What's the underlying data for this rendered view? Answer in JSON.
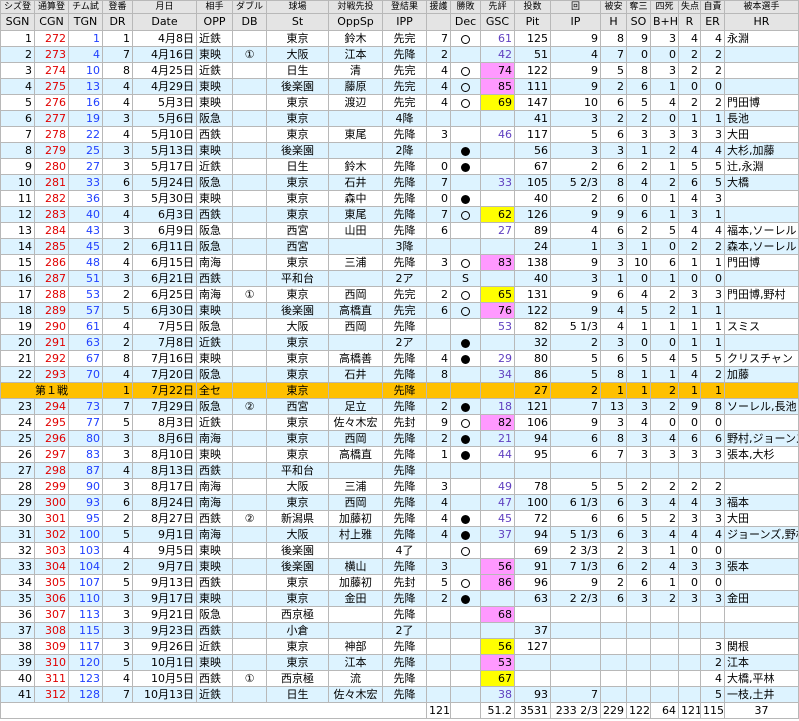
{
  "header_jp": [
    "シズ登",
    "通算登",
    "チム試",
    "登番",
    "月日",
    "相手",
    "ダブル",
    "球場",
    "対戦先投",
    "登結果",
    "援護",
    "勝敗",
    "先評",
    "投数",
    "回",
    "被安",
    "奪三",
    "四死",
    "失点",
    "自責",
    "被本選手"
  ],
  "header_en": [
    "SGN",
    "CGN",
    "TGN",
    "DR",
    "Date",
    "OPP",
    "DB",
    "St",
    "OppSp",
    "IPP",
    "",
    "Dec",
    "GSC",
    "Pit",
    "IP",
    "H",
    "SO",
    "B+H",
    "R",
    "ER",
    "HR"
  ],
  "rows": [
    {
      "sgn": "1",
      "cgn": "272",
      "tgn": "1",
      "dr": "1",
      "date": "4月8日",
      "opp": "近鉄",
      "db": "",
      "st": "東京",
      "oppsp": "鈴木",
      "ipp": "先完",
      "sup": "7",
      "dec": "o",
      "gsc": "61",
      "gsc_style": "none",
      "pit": "125",
      "ip": "9",
      "h": "8",
      "so": "9",
      "bh": "3",
      "r": "4",
      "er": "4",
      "hr": "永淵"
    },
    {
      "sgn": "2",
      "cgn": "273",
      "tgn": "4",
      "dr": "7",
      "date": "4月16日",
      "opp": "東映",
      "db": "①",
      "st": "大阪",
      "oppsp": "江本",
      "ipp": "先降",
      "sup": "2",
      "dec": "",
      "gsc": "42",
      "gsc_style": "none",
      "pit": "51",
      "ip": "4",
      "h": "7",
      "so": "0",
      "bh": "0",
      "r": "2",
      "er": "2",
      "hr": ""
    },
    {
      "sgn": "3",
      "cgn": "274",
      "tgn": "10",
      "dr": "8",
      "date": "4月25日",
      "opp": "近鉄",
      "db": "",
      "st": "日生",
      "oppsp": "清",
      "ipp": "先完",
      "sup": "4",
      "dec": "o",
      "gsc": "74",
      "gsc_style": "pink",
      "pit": "122",
      "ip": "9",
      "h": "5",
      "so": "8",
      "bh": "3",
      "r": "2",
      "er": "2",
      "hr": ""
    },
    {
      "sgn": "4",
      "cgn": "275",
      "tgn": "13",
      "dr": "4",
      "date": "4月29日",
      "opp": "東映",
      "db": "",
      "st": "後楽園",
      "oppsp": "藤原",
      "ipp": "先完",
      "sup": "4",
      "dec": "o",
      "gsc": "85",
      "gsc_style": "pink",
      "pit": "111",
      "ip": "9",
      "h": "2",
      "so": "6",
      "bh": "1",
      "r": "0",
      "er": "0",
      "hr": ""
    },
    {
      "sgn": "5",
      "cgn": "276",
      "tgn": "16",
      "dr": "4",
      "date": "5月3日",
      "opp": "東映",
      "db": "",
      "st": "東京",
      "oppsp": "渡辺",
      "ipp": "先完",
      "sup": "4",
      "dec": "o",
      "gsc": "69",
      "gsc_style": "ylw",
      "pit": "147",
      "ip": "10",
      "h": "6",
      "so": "5",
      "bh": "4",
      "r": "2",
      "er": "2",
      "hr": "門田博"
    },
    {
      "sgn": "6",
      "cgn": "277",
      "tgn": "19",
      "dr": "3",
      "date": "5月6日",
      "opp": "阪急",
      "db": "",
      "st": "東京",
      "oppsp": "",
      "ipp": "4降",
      "sup": "",
      "dec": "",
      "gsc": "",
      "gsc_style": "none",
      "pit": "41",
      "ip": "3",
      "h": "2",
      "so": "2",
      "bh": "0",
      "r": "1",
      "er": "1",
      "hr": "長池"
    },
    {
      "sgn": "7",
      "cgn": "278",
      "tgn": "22",
      "dr": "4",
      "date": "5月10日",
      "opp": "西鉄",
      "db": "",
      "st": "東京",
      "oppsp": "東尾",
      "ipp": "先降",
      "sup": "3",
      "dec": "",
      "gsc": "46",
      "gsc_style": "none",
      "pit": "117",
      "ip": "5",
      "h": "6",
      "so": "3",
      "bh": "3",
      "r": "3",
      "er": "3",
      "hr": "大田"
    },
    {
      "sgn": "8",
      "cgn": "279",
      "tgn": "25",
      "dr": "3",
      "date": "5月13日",
      "opp": "東映",
      "db": "",
      "st": "後楽園",
      "oppsp": "",
      "ipp": "2降",
      "sup": "",
      "dec": "b",
      "gsc": "",
      "gsc_style": "none",
      "pit": "56",
      "ip": "3",
      "h": "3",
      "so": "1",
      "bh": "2",
      "r": "4",
      "er": "4",
      "hr": "大杉,加藤"
    },
    {
      "sgn": "9",
      "cgn": "280",
      "tgn": "27",
      "dr": "3",
      "date": "5月17日",
      "opp": "近鉄",
      "db": "",
      "st": "日生",
      "oppsp": "鈴木",
      "ipp": "先降",
      "sup": "0",
      "dec": "b",
      "gsc": "",
      "gsc_style": "none",
      "pit": "67",
      "ip": "2",
      "h": "6",
      "so": "2",
      "bh": "1",
      "r": "5",
      "er": "5",
      "hr": "辻,永淵"
    },
    {
      "sgn": "10",
      "cgn": "281",
      "tgn": "33",
      "dr": "6",
      "date": "5月24日",
      "opp": "阪急",
      "db": "",
      "st": "東京",
      "oppsp": "石井",
      "ipp": "先降",
      "sup": "7",
      "dec": "",
      "gsc": "33",
      "gsc_style": "none",
      "pit": "105",
      "ip": "5 2/3",
      "h": "8",
      "so": "4",
      "bh": "2",
      "r": "6",
      "er": "5",
      "hr": "大橋"
    },
    {
      "sgn": "11",
      "cgn": "282",
      "tgn": "36",
      "dr": "3",
      "date": "5月30日",
      "opp": "東映",
      "db": "",
      "st": "東京",
      "oppsp": "森中",
      "ipp": "先降",
      "sup": "0",
      "dec": "b",
      "gsc": "",
      "gsc_style": "none",
      "pit": "40",
      "ip": "2",
      "h": "6",
      "so": "0",
      "bh": "1",
      "r": "4",
      "er": "3",
      "hr": ""
    },
    {
      "sgn": "12",
      "cgn": "283",
      "tgn": "40",
      "dr": "4",
      "date": "6月3日",
      "opp": "西鉄",
      "db": "",
      "st": "東京",
      "oppsp": "東尾",
      "ipp": "先降",
      "sup": "7",
      "dec": "o",
      "gsc": "62",
      "gsc_style": "ylw",
      "pit": "126",
      "ip": "9",
      "h": "9",
      "so": "6",
      "bh": "1",
      "r": "3",
      "er": "1",
      "hr": ""
    },
    {
      "sgn": "13",
      "cgn": "284",
      "tgn": "43",
      "dr": "3",
      "date": "6月9日",
      "opp": "阪急",
      "db": "",
      "st": "西宮",
      "oppsp": "山田",
      "ipp": "先降",
      "sup": "6",
      "dec": "",
      "gsc": "27",
      "gsc_style": "none",
      "pit": "89",
      "ip": "4",
      "h": "6",
      "so": "2",
      "bh": "5",
      "r": "4",
      "er": "4",
      "hr": "福本,ソーレル"
    },
    {
      "sgn": "14",
      "cgn": "285",
      "tgn": "45",
      "dr": "2",
      "date": "6月11日",
      "opp": "阪急",
      "db": "",
      "st": "西宮",
      "oppsp": "",
      "ipp": "3降",
      "sup": "",
      "dec": "",
      "gsc": "",
      "gsc_style": "none",
      "pit": "24",
      "ip": "1",
      "h": "3",
      "so": "1",
      "bh": "0",
      "r": "2",
      "er": "2",
      "hr": "森本,ソーレル"
    },
    {
      "sgn": "15",
      "cgn": "286",
      "tgn": "48",
      "dr": "4",
      "date": "6月15日",
      "opp": "南海",
      "db": "",
      "st": "東京",
      "oppsp": "三浦",
      "ipp": "先降",
      "sup": "3",
      "dec": "o",
      "gsc": "83",
      "gsc_style": "pink",
      "pit": "138",
      "ip": "9",
      "h": "3",
      "so": "10",
      "bh": "6",
      "r": "1",
      "er": "1",
      "hr": "門田博"
    },
    {
      "sgn": "16",
      "cgn": "287",
      "tgn": "51",
      "dr": "3",
      "date": "6月21日",
      "opp": "西鉄",
      "db": "",
      "st": "平和台",
      "oppsp": "",
      "ipp": "2ア",
      "sup": "",
      "dec": "S",
      "gsc": "",
      "gsc_style": "none",
      "pit": "40",
      "ip": "3",
      "h": "1",
      "so": "0",
      "bh": "1",
      "r": "0",
      "er": "0",
      "hr": ""
    },
    {
      "sgn": "17",
      "cgn": "288",
      "tgn": "53",
      "dr": "2",
      "date": "6月25日",
      "opp": "南海",
      "db": "①",
      "st": "東京",
      "oppsp": "西岡",
      "ipp": "先完",
      "sup": "2",
      "dec": "o",
      "gsc": "65",
      "gsc_style": "ylw",
      "pit": "131",
      "ip": "9",
      "h": "6",
      "so": "4",
      "bh": "2",
      "r": "3",
      "er": "3",
      "hr": "門田博,野村"
    },
    {
      "sgn": "18",
      "cgn": "289",
      "tgn": "57",
      "dr": "5",
      "date": "6月30日",
      "opp": "東映",
      "db": "",
      "st": "後楽園",
      "oppsp": "高橋直",
      "ipp": "先完",
      "sup": "6",
      "dec": "o",
      "gsc": "76",
      "gsc_style": "pink",
      "pit": "122",
      "ip": "9",
      "h": "4",
      "so": "5",
      "bh": "2",
      "r": "1",
      "er": "1",
      "hr": ""
    },
    {
      "sgn": "19",
      "cgn": "290",
      "tgn": "61",
      "dr": "4",
      "date": "7月5日",
      "opp": "阪急",
      "db": "",
      "st": "大阪",
      "oppsp": "西岡",
      "ipp": "先降",
      "sup": "",
      "dec": "",
      "gsc": "53",
      "gsc_style": "none",
      "pit": "82",
      "ip": "5 1/3",
      "h": "4",
      "so": "1",
      "bh": "1",
      "r": "1",
      "er": "1",
      "hr": "スミス"
    },
    {
      "sgn": "20",
      "cgn": "291",
      "tgn": "63",
      "dr": "2",
      "date": "7月8日",
      "opp": "近鉄",
      "db": "",
      "st": "東京",
      "oppsp": "",
      "ipp": "2ア",
      "sup": "",
      "dec": "b",
      "gsc": "",
      "gsc_style": "none",
      "pit": "32",
      "ip": "2",
      "h": "3",
      "so": "0",
      "bh": "0",
      "r": "1",
      "er": "1",
      "hr": ""
    },
    {
      "sgn": "21",
      "cgn": "292",
      "tgn": "67",
      "dr": "8",
      "date": "7月16日",
      "opp": "東映",
      "db": "",
      "st": "東京",
      "oppsp": "高橋善",
      "ipp": "先降",
      "sup": "4",
      "dec": "b",
      "gsc": "29",
      "gsc_style": "none",
      "pit": "80",
      "ip": "5",
      "h": "6",
      "so": "5",
      "bh": "4",
      "r": "5",
      "er": "5",
      "hr": "クリスチャン"
    },
    {
      "sgn": "22",
      "cgn": "293",
      "tgn": "70",
      "dr": "4",
      "date": "7月20日",
      "opp": "阪急",
      "db": "",
      "st": "東京",
      "oppsp": "石井",
      "ipp": "先降",
      "sup": "8",
      "dec": "",
      "gsc": "34",
      "gsc_style": "none",
      "pit": "86",
      "ip": "5",
      "h": "8",
      "so": "1",
      "bh": "1",
      "r": "4",
      "er": "2",
      "hr": "加藤"
    },
    {
      "special": true,
      "label": "第１戦",
      "dr": "1",
      "date": "7月22日",
      "opp": "全セ",
      "db": "",
      "st": "東京",
      "oppsp": "",
      "ipp": "先降",
      "sup": "",
      "dec": "",
      "gsc": "",
      "gsc_style": "none",
      "pit": "27",
      "ip": "2",
      "h": "1",
      "so": "1",
      "bh": "2",
      "r": "1",
      "er": "1",
      "hr": ""
    },
    {
      "sgn": "23",
      "cgn": "294",
      "tgn": "73",
      "dr": "7",
      "date": "7月29日",
      "opp": "阪急",
      "db": "②",
      "st": "西宮",
      "oppsp": "足立",
      "ipp": "先降",
      "sup": "2",
      "dec": "b",
      "gsc": "18",
      "gsc_style": "none",
      "pit": "121",
      "ip": "7",
      "h": "13",
      "so": "3",
      "bh": "2",
      "r": "9",
      "er": "8",
      "hr": "ソーレル,長池"
    },
    {
      "sgn": "24",
      "cgn": "295",
      "tgn": "77",
      "dr": "5",
      "date": "8月3日",
      "opp": "近鉄",
      "db": "",
      "st": "東京",
      "oppsp": "佐々木宏",
      "ipp": "先封",
      "sup": "9",
      "dec": "o",
      "gsc": "82",
      "gsc_style": "pink",
      "pit": "106",
      "ip": "9",
      "h": "3",
      "so": "4",
      "bh": "0",
      "r": "0",
      "er": "0",
      "hr": ""
    },
    {
      "sgn": "25",
      "cgn": "296",
      "tgn": "80",
      "dr": "3",
      "date": "8月6日",
      "opp": "南海",
      "db": "",
      "st": "東京",
      "oppsp": "西岡",
      "ipp": "先降",
      "sup": "2",
      "dec": "b",
      "gsc": "21",
      "gsc_style": "none",
      "pit": "94",
      "ip": "6",
      "h": "8",
      "so": "3",
      "bh": "4",
      "r": "6",
      "er": "6",
      "hr": "野村,ジョーンズ"
    },
    {
      "sgn": "26",
      "cgn": "297",
      "tgn": "83",
      "dr": "3",
      "date": "8月10日",
      "opp": "東映",
      "db": "",
      "st": "東京",
      "oppsp": "高橋直",
      "ipp": "先降",
      "sup": "1",
      "dec": "b",
      "gsc": "44",
      "gsc_style": "none",
      "pit": "95",
      "ip": "6",
      "h": "7",
      "so": "3",
      "bh": "3",
      "r": "3",
      "er": "3",
      "hr": "張本,大杉"
    },
    {
      "sgn": "27",
      "cgn": "298",
      "tgn": "87",
      "dr": "4",
      "date": "8月13日",
      "opp": "西鉄",
      "db": "",
      "st": "平和台",
      "oppsp": "",
      "ipp": "先降",
      "sup": "",
      "dec": "",
      "gsc": "",
      "gsc_style": "none",
      "pit": "",
      "ip": "",
      "h": "",
      "so": "",
      "bh": "",
      "r": "",
      "er": "",
      "hr": ""
    },
    {
      "sgn": "28",
      "cgn": "299",
      "tgn": "90",
      "dr": "3",
      "date": "8月17日",
      "opp": "南海",
      "db": "",
      "st": "大阪",
      "oppsp": "三浦",
      "ipp": "先降",
      "sup": "3",
      "dec": "",
      "gsc": "49",
      "gsc_style": "none",
      "pit": "78",
      "ip": "5",
      "h": "5",
      "so": "2",
      "bh": "2",
      "r": "2",
      "er": "2",
      "hr": ""
    },
    {
      "sgn": "29",
      "cgn": "300",
      "tgn": "93",
      "dr": "6",
      "date": "8月24日",
      "opp": "南海",
      "db": "",
      "st": "東京",
      "oppsp": "西岡",
      "ipp": "先降",
      "sup": "4",
      "dec": "",
      "gsc": "47",
      "gsc_style": "none",
      "pit": "100",
      "ip": "6 1/3",
      "h": "6",
      "so": "3",
      "bh": "4",
      "r": "4",
      "er": "3",
      "hr": "福本"
    },
    {
      "sgn": "30",
      "cgn": "301",
      "tgn": "95",
      "dr": "2",
      "date": "8月27日",
      "opp": "西鉄",
      "db": "②",
      "st": "新潟県",
      "oppsp": "加藤初",
      "ipp": "先降",
      "sup": "4",
      "dec": "b",
      "gsc": "45",
      "gsc_style": "none",
      "pit": "72",
      "ip": "6",
      "h": "6",
      "so": "5",
      "bh": "2",
      "r": "3",
      "er": "3",
      "hr": "大田"
    },
    {
      "sgn": "31",
      "cgn": "302",
      "tgn": "100",
      "dr": "5",
      "date": "9月1日",
      "opp": "南海",
      "db": "",
      "st": "大阪",
      "oppsp": "村上雅",
      "ipp": "先降",
      "sup": "4",
      "dec": "b",
      "gsc": "37",
      "gsc_style": "none",
      "pit": "94",
      "ip": "5 1/3",
      "h": "6",
      "so": "3",
      "bh": "4",
      "r": "4",
      "er": "4",
      "hr": "ジョーンズ,野村"
    },
    {
      "sgn": "32",
      "cgn": "303",
      "tgn": "103",
      "dr": "4",
      "date": "9月5日",
      "opp": "東映",
      "db": "",
      "st": "後楽園",
      "oppsp": "",
      "ipp": "4了",
      "sup": "",
      "dec": "o",
      "gsc": "",
      "gsc_style": "none",
      "pit": "69",
      "ip": "2 3/3",
      "h": "2",
      "so": "3",
      "bh": "1",
      "r": "0",
      "er": "0",
      "hr": ""
    },
    {
      "sgn": "33",
      "cgn": "304",
      "tgn": "104",
      "dr": "2",
      "date": "9月7日",
      "opp": "東映",
      "db": "",
      "st": "後楽園",
      "oppsp": "横山",
      "ipp": "先降",
      "sup": "3",
      "dec": "",
      "gsc": "56",
      "gsc_style": "pink",
      "pit": "91",
      "ip": "7 1/3",
      "h": "6",
      "so": "2",
      "bh": "4",
      "r": "3",
      "er": "3",
      "hr": "張本"
    },
    {
      "sgn": "34",
      "cgn": "305",
      "tgn": "107",
      "dr": "5",
      "date": "9月13日",
      "opp": "西鉄",
      "db": "",
      "st": "東京",
      "oppsp": "加藤初",
      "ipp": "先封",
      "sup": "5",
      "dec": "o",
      "gsc": "86",
      "gsc_style": "pink",
      "pit": "96",
      "ip": "9",
      "h": "2",
      "so": "6",
      "bh": "1",
      "r": "0",
      "er": "0",
      "hr": ""
    },
    {
      "sgn": "35",
      "cgn": "306",
      "tgn": "110",
      "dr": "3",
      "date": "9月17日",
      "opp": "東映",
      "db": "",
      "st": "東京",
      "oppsp": "金田",
      "ipp": "先降",
      "sup": "2",
      "dec": "b",
      "gsc": "",
      "gsc_style": "none",
      "pit": "63",
      "ip": "2 2/3",
      "h": "6",
      "so": "3",
      "bh": "2",
      "r": "3",
      "er": "3",
      "hr": "金田"
    },
    {
      "sgn": "36",
      "cgn": "307",
      "tgn": "113",
      "dr": "3",
      "date": "9月21日",
      "opp": "阪急",
      "db": "",
      "st": "西京極",
      "oppsp": "",
      "ipp": "先降",
      "sup": "",
      "dec": "",
      "gsc": "68",
      "gsc_style": "pink",
      "pit": "",
      "ip": "",
      "h": "",
      "so": "",
      "bh": "",
      "r": "",
      "er": "",
      "hr": ""
    },
    {
      "sgn": "37",
      "cgn": "308",
      "tgn": "115",
      "dr": "3",
      "date": "9月23日",
      "opp": "西鉄",
      "db": "",
      "st": "小倉",
      "oppsp": "",
      "ipp": "2了",
      "sup": "",
      "dec": "",
      "gsc": "",
      "gsc_style": "none",
      "pit": "37",
      "ip": "",
      "h": "",
      "so": "",
      "bh": "",
      "r": "",
      "er": "",
      "hr": ""
    },
    {
      "sgn": "38",
      "cgn": "309",
      "tgn": "117",
      "dr": "3",
      "date": "9月26日",
      "opp": "近鉄",
      "db": "",
      "st": "東京",
      "oppsp": "神部",
      "ipp": "先降",
      "sup": "",
      "dec": "",
      "gsc": "56",
      "gsc_style": "ylw",
      "pit": "127",
      "ip": "",
      "h": "",
      "so": "",
      "bh": "",
      "r": "",
      "er": "3",
      "hr": "関根"
    },
    {
      "sgn": "39",
      "cgn": "310",
      "tgn": "120",
      "dr": "5",
      "date": "10月1日",
      "opp": "東映",
      "db": "",
      "st": "東京",
      "oppsp": "江本",
      "ipp": "先降",
      "sup": "",
      "dec": "",
      "gsc": "53",
      "gsc_style": "pink",
      "pit": "",
      "ip": "",
      "h": "",
      "so": "",
      "bh": "",
      "r": "",
      "er": "2",
      "hr": "江本"
    },
    {
      "sgn": "40",
      "cgn": "311",
      "tgn": "123",
      "dr": "4",
      "date": "10月5日",
      "opp": "西鉄",
      "db": "①",
      "st": "西京極",
      "oppsp": "流",
      "ipp": "先降",
      "sup": "",
      "dec": "",
      "gsc": "67",
      "gsc_style": "ylw",
      "pit": "",
      "ip": "",
      "h": "",
      "so": "",
      "bh": "",
      "r": "",
      "er": "4",
      "hr": "大橋,平林"
    },
    {
      "sgn": "41",
      "cgn": "312",
      "tgn": "128",
      "dr": "7",
      "date": "10月13日",
      "opp": "近鉄",
      "db": "",
      "st": "日生",
      "oppsp": "佐々木宏",
      "ipp": "先降",
      "sup": "",
      "dec": "",
      "gsc": "38",
      "gsc_style": "none",
      "pit": "93",
      "ip": "7",
      "h": "",
      "so": "",
      "bh": "",
      "r": "",
      "er": "5",
      "hr": "一枝,土井"
    }
  ],
  "totals": {
    "sup": "121",
    "gsc": "51.2",
    "pit": "3531",
    "ip": "233 2/3",
    "h": "229",
    "so": "122",
    "bh": "64",
    "r": "121",
    "er": "115",
    "hr": "37"
  }
}
